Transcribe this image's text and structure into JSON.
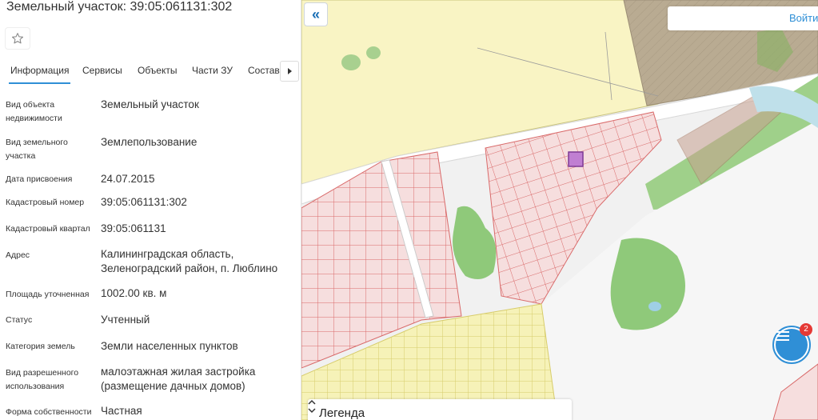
{
  "panel": {
    "title": "Земельный участок: 39:05:061131:302",
    "tabs": [
      "Информация",
      "Сервисы",
      "Объекты",
      "Части ЗУ",
      "Состав"
    ],
    "props": [
      {
        "label": "Вид объекта недвижимости",
        "value": "Земельный участок"
      },
      {
        "label": "Вид земельного участка",
        "value": "Землепользование"
      },
      {
        "label": "Дата присвоения",
        "value": "24.07.2015"
      },
      {
        "label": "Кадастровый номер",
        "value": "39:05:061131:302"
      },
      {
        "label": "Кадастровый квартал",
        "value": "39:05:061131"
      },
      {
        "label": "Адрес",
        "value": "Калининградская область, Зеленоградский район, п. Люблино"
      },
      {
        "label": "Площадь уточненная",
        "value": "1002.00 кв. м"
      },
      {
        "label": "Статус",
        "value": "Учтенный"
      },
      {
        "label": "Категория земель",
        "value": "Земли населенных пунктов"
      },
      {
        "label": "Вид разрешенного использования",
        "value": "малоэтажная жилая застройка (размещение дачных домов)"
      },
      {
        "label": "Форма собственности",
        "value": "Частная"
      }
    ]
  },
  "map": {
    "login_label": "Войти",
    "legend_label": "Легенда",
    "chat_badge": "2",
    "colors": {
      "accent": "#2f8fd6",
      "parcel_fill": "#f6dede",
      "parcel_line": "#d96a6a",
      "selected_parcel": "#c07fd2",
      "yellow_zone": "#f9f4c4",
      "green": "#8fc97a",
      "water": "#9fcfe6"
    }
  }
}
